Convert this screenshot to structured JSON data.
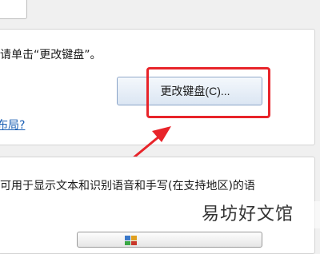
{
  "keyboards": {
    "instruction": "请单击“更改键盘”。",
    "change_button": "更改键盘(C)...",
    "layout_link_fragment": "布局?"
  },
  "language_bar": {
    "description": "可用于显示文本和识别语音和手写(在支持地区)的语"
  },
  "watermark": {
    "text": "易坊好文馆"
  },
  "colors": {
    "highlight": "#e8242a",
    "link": "#1a5fb4"
  }
}
